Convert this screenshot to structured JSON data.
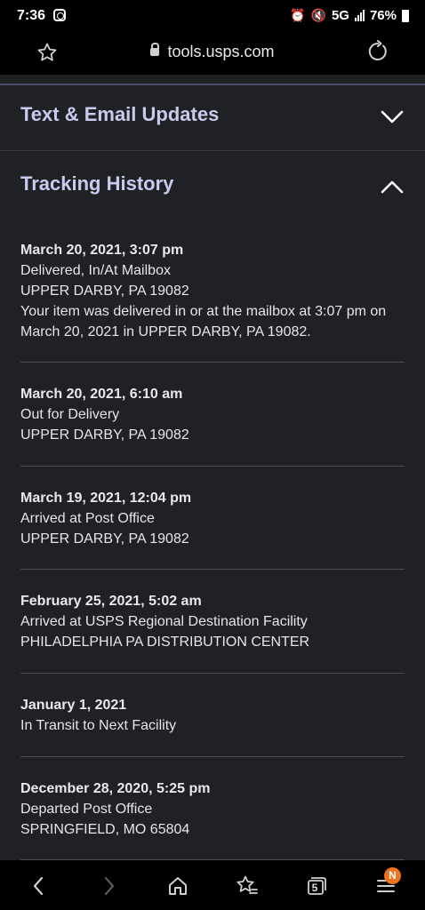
{
  "status_bar": {
    "time": "7:36",
    "network": "5G",
    "battery": "76%"
  },
  "browser": {
    "url": "tools.usps.com"
  },
  "sections": {
    "text_email": {
      "title": "Text & Email Updates"
    },
    "tracking_history": {
      "title": "Tracking History"
    }
  },
  "events": [
    {
      "date": "March 20, 2021, 3:07 pm",
      "status": "Delivered, In/At Mailbox",
      "location": "UPPER DARBY, PA 19082",
      "detail": "Your item was delivered in or at the mailbox at 3:07 pm on March 20, 2021 in UPPER DARBY, PA 19082."
    },
    {
      "date": "March 20, 2021, 6:10 am",
      "status": "Out for Delivery",
      "location": "UPPER DARBY, PA 19082"
    },
    {
      "date": "March 19, 2021, 12:04 pm",
      "status": "Arrived at Post Office",
      "location": "UPPER DARBY, PA 19082"
    },
    {
      "date": "February 25, 2021, 5:02 am",
      "status": "Arrived at USPS Regional Destination Facility",
      "location": "PHILADELPHIA PA DISTRIBUTION CENTER"
    },
    {
      "date": "January 1, 2021",
      "status": "In Transit to Next Facility"
    },
    {
      "date": "December 28, 2020, 5:25 pm",
      "status": "Departed Post Office",
      "location": "SPRINGFIELD, MO 65804"
    }
  ],
  "bottom_nav": {
    "tab_count": "5",
    "menu_badge": "N"
  },
  "icons": [
    "instagram-icon",
    "alarm-icon",
    "mute-icon",
    "signal-icon",
    "battery-icon",
    "star-icon",
    "lock-icon",
    "reload-icon",
    "chevron-down-icon",
    "chevron-up-icon",
    "back-icon",
    "forward-icon",
    "home-icon",
    "bookmarks-icon",
    "tabs-icon",
    "menu-icon"
  ],
  "colors": {
    "page_bg": "#202124",
    "heading": "#c9cbee",
    "badge": "#f0721e"
  }
}
